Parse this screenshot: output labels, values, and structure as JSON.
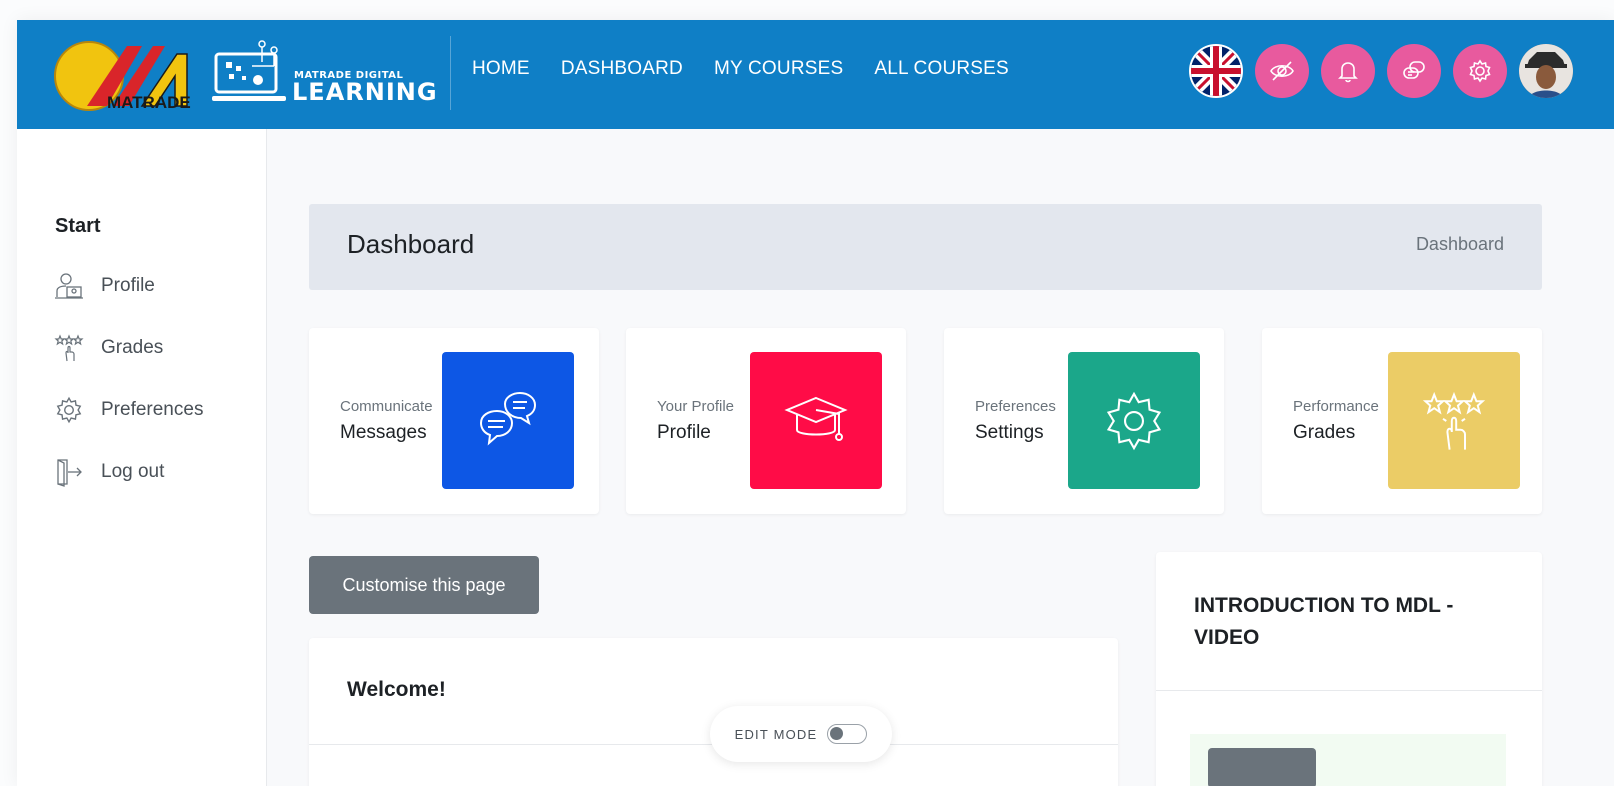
{
  "brand": {
    "matrade_text": "MATRADE",
    "mdl_small": "MATRADE DIGITAL",
    "mdl_big": "LEARNING"
  },
  "nav": {
    "items": [
      "HOME",
      "DASHBOARD",
      "MY COURSES",
      "ALL COURSES"
    ]
  },
  "header_icons": [
    "uk-flag-icon",
    "eye-slash-icon",
    "bell-icon",
    "chat-icon",
    "gear-icon",
    "avatar"
  ],
  "sidebar": {
    "title": "Start",
    "items": [
      {
        "label": "Profile",
        "icon": "profile-icon"
      },
      {
        "label": "Grades",
        "icon": "grades-icon"
      },
      {
        "label": "Preferences",
        "icon": "gear-icon"
      },
      {
        "label": "Log out",
        "icon": "logout-icon"
      }
    ]
  },
  "page_header": {
    "title": "Dashboard",
    "breadcrumb": "Dashboard"
  },
  "cards": [
    {
      "small": "Communicate",
      "big": "Messages",
      "color": "#0d57e5",
      "icon": "messages-icon"
    },
    {
      "small": "Your Profile",
      "big": "Profile",
      "color": "#ff0c47",
      "icon": "graduation-cap-icon"
    },
    {
      "small": "Preferences",
      "big": "Settings",
      "color": "#1ba78a",
      "icon": "gear-icon"
    },
    {
      "small": "Performance",
      "big": "Grades",
      "color": "#ebcc66",
      "icon": "grades-icon"
    }
  ],
  "customise_button": "Customise this page",
  "welcome": {
    "title": "Welcome!"
  },
  "intro_block": {
    "title": "INTRODUCTION TO MDL - VIDEO"
  },
  "edit_mode": {
    "label": "EDIT MODE",
    "enabled": false
  },
  "colors": {
    "topbar": "#0f7fc6",
    "header_icon_bg": "#e85a9e",
    "button_gray": "#6a737b"
  }
}
